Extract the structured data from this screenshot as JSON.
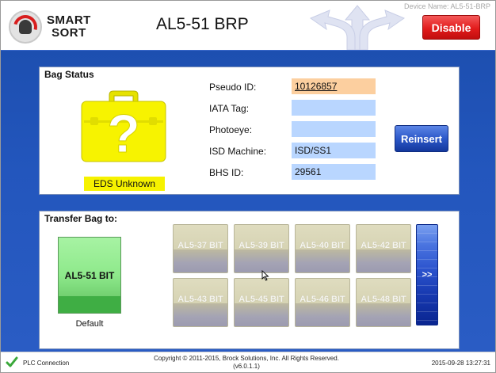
{
  "header": {
    "logo_line1": "SMART",
    "logo_line2": "SORT",
    "title": "AL5-51 BRP",
    "device_name": "Device Name: AL5-51-BRP",
    "disable_label": "Disable",
    "icons": [
      "smart-sort-logo-icon",
      "direction-arrows-icon"
    ]
  },
  "bag_status": {
    "title": "Bag Status",
    "eds_status": "EDS Unknown",
    "bag_icon": "unknown-bag-icon",
    "fields": [
      {
        "label": "Pseudo ID:",
        "value": "10126857"
      },
      {
        "label": "IATA Tag:",
        "value": ""
      },
      {
        "label": "Photoeye:",
        "value": ""
      },
      {
        "label": "ISD Machine:",
        "value": "ISD/SS1"
      },
      {
        "label": "BHS ID:",
        "value": "29561"
      }
    ],
    "reinsert_label": "Reinsert"
  },
  "transfer": {
    "title": "Transfer Bag to:",
    "default_tile": "AL5-51 BIT",
    "default_label": "Default",
    "destinations": [
      "AL5-37 BIT",
      "AL5-39 BIT",
      "AL5-40 BIT",
      "AL5-42 BIT",
      "AL5-43 BIT",
      "AL5-45 BIT",
      "AL5-46 BIT",
      "AL5-48 BIT"
    ],
    "next_label": ">>"
  },
  "footer": {
    "plc_status": "PLC Connection",
    "copyright_line1": "Copyright © 2011-2015, Brock Solutions, Inc. All Rights Reserved.",
    "copyright_line2": "(v6.0.1.1)",
    "timestamp": "2015-09-28 13:27:31"
  },
  "colors": {
    "brand_red": "#e21c1c",
    "main_blue": "#2356bd",
    "field_blue": "#b9d6ff",
    "pseudo_orange": "#fccf9f",
    "eds_yellow": "#f6f200",
    "default_green": "#8ee98b",
    "plc_ok_green": "#3aa83a"
  }
}
